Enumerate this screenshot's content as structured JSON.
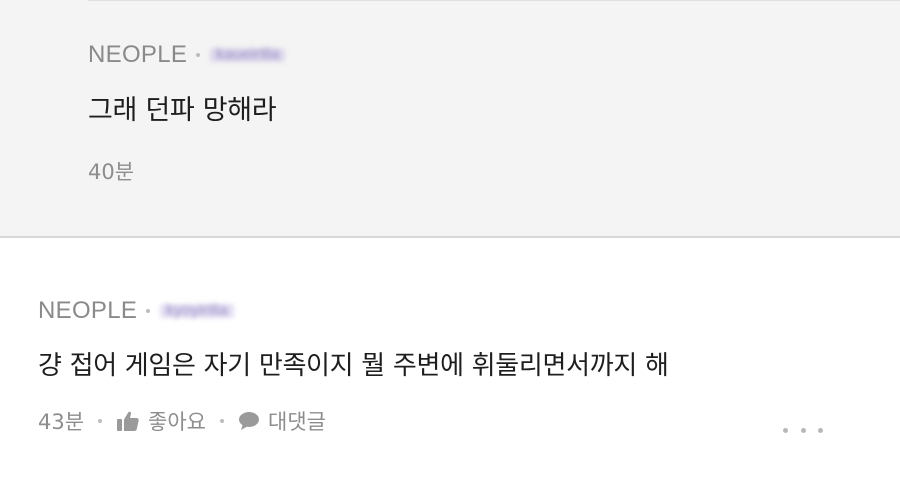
{
  "reply": {
    "author": "NEOPLE",
    "user_id": "kaueirilla",
    "text": "그래 던파 망해라",
    "time": "40분"
  },
  "comment": {
    "author": "NEOPLE",
    "user_id": "kyoyirilla",
    "text": "걍 접어 게임은 자기 만족이지 뭘 주변에 휘둘리면서까지 해",
    "time": "43분",
    "like_label": "좋아요",
    "reply_label": "대댓글",
    "like_icon": "thumbs-up-icon",
    "reply_icon": "speech-bubble-icon",
    "more_icon": "more-dots-icon"
  },
  "colors": {
    "reply_background": "#f4f4f4",
    "page_background": "#ffffff",
    "meta_text": "#8a8a8a",
    "body_text": "#1e1e1e"
  }
}
